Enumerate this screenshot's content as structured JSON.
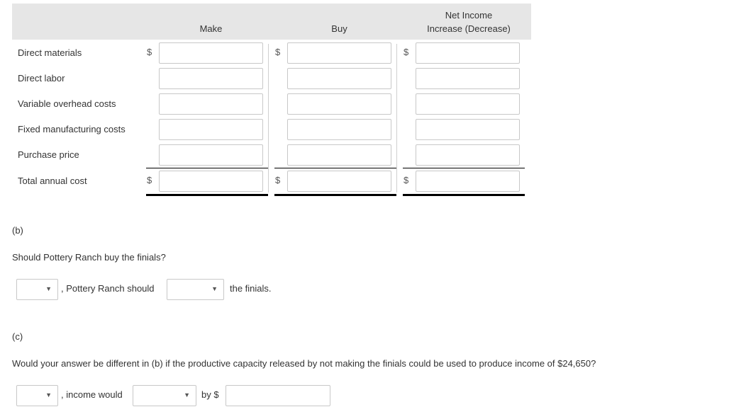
{
  "table": {
    "columns": [
      {
        "id": "make",
        "label": "Make"
      },
      {
        "id": "buy",
        "label": "Buy"
      },
      {
        "id": "net",
        "label_line1": "Net Income",
        "label_line2": "Increase (Decrease)"
      }
    ],
    "currency_symbol": "$",
    "rows": [
      {
        "label": "Direct materials",
        "values": [
          "",
          "",
          ""
        ]
      },
      {
        "label": "Direct labor",
        "values": [
          "",
          "",
          ""
        ]
      },
      {
        "label": "Variable overhead costs",
        "values": [
          "",
          "",
          ""
        ]
      },
      {
        "label": "Fixed manufacturing costs",
        "values": [
          "",
          "",
          ""
        ]
      },
      {
        "label": "Purchase price",
        "values": [
          "",
          "",
          ""
        ]
      },
      {
        "label": "Total annual cost",
        "values": [
          "",
          "",
          ""
        ]
      }
    ]
  },
  "part_b": {
    "label": "(b)",
    "question": "Should Pottery Ranch buy the finials?",
    "select1_value": "",
    "text1": ", Pottery Ranch should",
    "select2_value": "",
    "text2": "the finials."
  },
  "part_c": {
    "label": "(c)",
    "question": "Would your answer be different in (b) if the productive capacity released by not making the finials could be used to produce income of $24,650?",
    "select1_value": "",
    "text1": ", income would",
    "select2_value": "",
    "text2": "by $",
    "amount_value": ""
  },
  "icons": {
    "caret": "▼"
  }
}
